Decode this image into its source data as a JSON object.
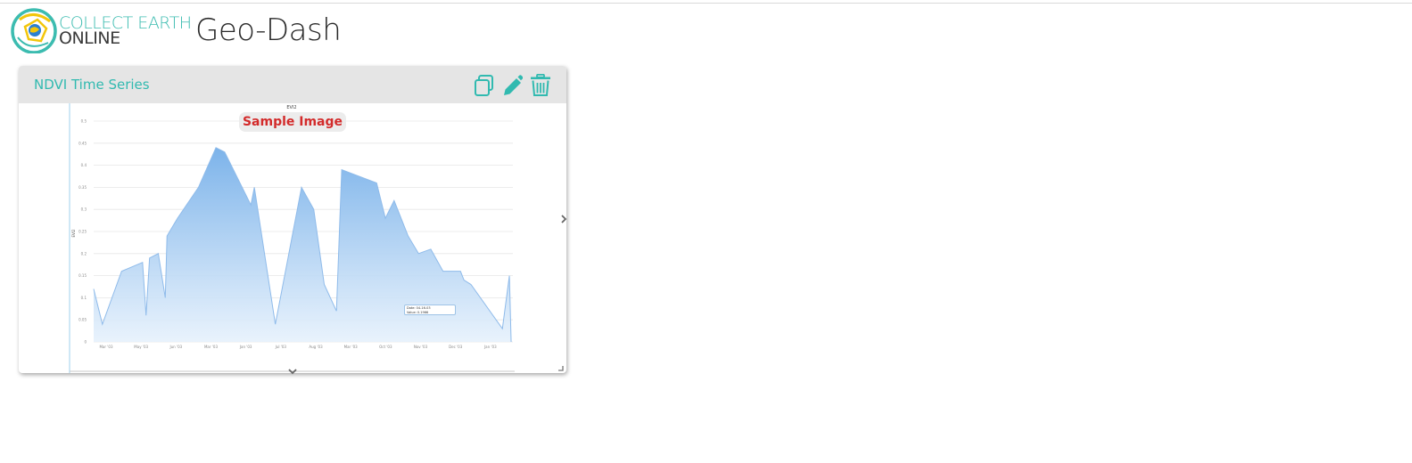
{
  "header": {
    "logo_line1": "COLLECT EARTH",
    "logo_line2": "ONLINE",
    "logo_icon": "collect-earth-globe-logo",
    "app_title": "Geo-Dash"
  },
  "widget": {
    "title": "NDVI Time Series",
    "buttons": [
      {
        "name": "copy-button",
        "icon": "copy-icon"
      },
      {
        "name": "edit-button",
        "icon": "pencil-icon"
      },
      {
        "name": "delete-button",
        "icon": "trash-icon"
      }
    ],
    "badge": "Sample Image",
    "accent_color": "#31bab0",
    "header_bg": "#e5e5e5"
  },
  "chart_data": {
    "type": "area",
    "title": "EVI2",
    "ylabel": "EVI2",
    "xlabel": "",
    "ylim": [
      0,
      0.5
    ],
    "yticks": [
      0,
      0.05,
      0.1,
      0.15,
      0.2,
      0.25,
      0.3,
      0.35,
      0.4,
      0.45,
      0.5
    ],
    "ytick_labels": [
      "0",
      "0.05",
      "0.1",
      "0.15",
      "0.2",
      "0.25",
      "0.3",
      "0.35",
      "0.4",
      "0.45",
      "0.5"
    ],
    "xlim": [
      0,
      12
    ],
    "xticks": [
      0,
      1,
      2,
      3,
      4,
      5,
      6,
      7,
      8,
      9,
      10,
      11
    ],
    "xtick_labels": [
      "Mar '03",
      "May '03",
      "Jun '03",
      "Mar '03",
      "Jan '03",
      "Jul '03",
      "Aug '03",
      "Mar '03",
      "Oct '03",
      "Nov '03",
      "Dec '03",
      "Jan '03"
    ],
    "series": [
      {
        "color": "#8fbbea",
        "points": [
          [
            0.0,
            0.12
          ],
          [
            0.25,
            0.04
          ],
          [
            0.8,
            0.16
          ],
          [
            1.4,
            0.18
          ],
          [
            1.5,
            0.06
          ],
          [
            1.6,
            0.19
          ],
          [
            1.85,
            0.2
          ],
          [
            2.05,
            0.1
          ],
          [
            2.1,
            0.24
          ],
          [
            2.4,
            0.28
          ],
          [
            3.0,
            0.35
          ],
          [
            3.5,
            0.44
          ],
          [
            3.75,
            0.43
          ],
          [
            4.5,
            0.31
          ],
          [
            4.6,
            0.35
          ],
          [
            5.2,
            0.04
          ],
          [
            5.95,
            0.35
          ],
          [
            6.3,
            0.3
          ],
          [
            6.6,
            0.13
          ],
          [
            6.95,
            0.07
          ],
          [
            7.1,
            0.39
          ],
          [
            8.1,
            0.36
          ],
          [
            8.35,
            0.28
          ],
          [
            8.6,
            0.32
          ],
          [
            9.0,
            0.24
          ],
          [
            9.3,
            0.2
          ],
          [
            9.65,
            0.21
          ],
          [
            10.0,
            0.16
          ],
          [
            10.5,
            0.16
          ],
          [
            10.6,
            0.14
          ],
          [
            10.8,
            0.13
          ],
          [
            11.7,
            0.03
          ],
          [
            11.9,
            0.15
          ],
          [
            11.95,
            0.0
          ]
        ]
      }
    ],
    "tooltip": {
      "line1": "Date: 04-16-03",
      "line2": "Value: 0.1966"
    },
    "grid": true,
    "legend": "none"
  }
}
